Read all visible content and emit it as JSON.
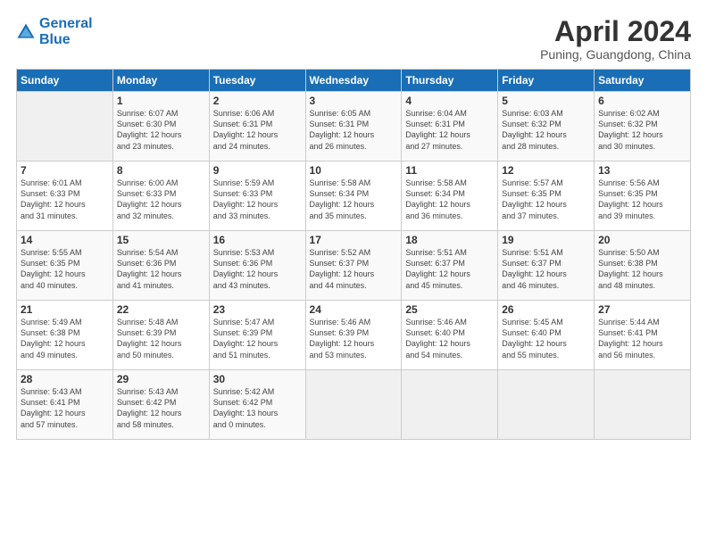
{
  "header": {
    "logo_line1": "General",
    "logo_line2": "Blue",
    "month": "April 2024",
    "location": "Puning, Guangdong, China"
  },
  "columns": [
    "Sunday",
    "Monday",
    "Tuesday",
    "Wednesday",
    "Thursday",
    "Friday",
    "Saturday"
  ],
  "weeks": [
    [
      {
        "day": "",
        "info": ""
      },
      {
        "day": "1",
        "info": "Sunrise: 6:07 AM\nSunset: 6:30 PM\nDaylight: 12 hours\nand 23 minutes."
      },
      {
        "day": "2",
        "info": "Sunrise: 6:06 AM\nSunset: 6:31 PM\nDaylight: 12 hours\nand 24 minutes."
      },
      {
        "day": "3",
        "info": "Sunrise: 6:05 AM\nSunset: 6:31 PM\nDaylight: 12 hours\nand 26 minutes."
      },
      {
        "day": "4",
        "info": "Sunrise: 6:04 AM\nSunset: 6:31 PM\nDaylight: 12 hours\nand 27 minutes."
      },
      {
        "day": "5",
        "info": "Sunrise: 6:03 AM\nSunset: 6:32 PM\nDaylight: 12 hours\nand 28 minutes."
      },
      {
        "day": "6",
        "info": "Sunrise: 6:02 AM\nSunset: 6:32 PM\nDaylight: 12 hours\nand 30 minutes."
      }
    ],
    [
      {
        "day": "7",
        "info": "Sunrise: 6:01 AM\nSunset: 6:33 PM\nDaylight: 12 hours\nand 31 minutes."
      },
      {
        "day": "8",
        "info": "Sunrise: 6:00 AM\nSunset: 6:33 PM\nDaylight: 12 hours\nand 32 minutes."
      },
      {
        "day": "9",
        "info": "Sunrise: 5:59 AM\nSunset: 6:33 PM\nDaylight: 12 hours\nand 33 minutes."
      },
      {
        "day": "10",
        "info": "Sunrise: 5:58 AM\nSunset: 6:34 PM\nDaylight: 12 hours\nand 35 minutes."
      },
      {
        "day": "11",
        "info": "Sunrise: 5:58 AM\nSunset: 6:34 PM\nDaylight: 12 hours\nand 36 minutes."
      },
      {
        "day": "12",
        "info": "Sunrise: 5:57 AM\nSunset: 6:35 PM\nDaylight: 12 hours\nand 37 minutes."
      },
      {
        "day": "13",
        "info": "Sunrise: 5:56 AM\nSunset: 6:35 PM\nDaylight: 12 hours\nand 39 minutes."
      }
    ],
    [
      {
        "day": "14",
        "info": "Sunrise: 5:55 AM\nSunset: 6:35 PM\nDaylight: 12 hours\nand 40 minutes."
      },
      {
        "day": "15",
        "info": "Sunrise: 5:54 AM\nSunset: 6:36 PM\nDaylight: 12 hours\nand 41 minutes."
      },
      {
        "day": "16",
        "info": "Sunrise: 5:53 AM\nSunset: 6:36 PM\nDaylight: 12 hours\nand 43 minutes."
      },
      {
        "day": "17",
        "info": "Sunrise: 5:52 AM\nSunset: 6:37 PM\nDaylight: 12 hours\nand 44 minutes."
      },
      {
        "day": "18",
        "info": "Sunrise: 5:51 AM\nSunset: 6:37 PM\nDaylight: 12 hours\nand 45 minutes."
      },
      {
        "day": "19",
        "info": "Sunrise: 5:51 AM\nSunset: 6:37 PM\nDaylight: 12 hours\nand 46 minutes."
      },
      {
        "day": "20",
        "info": "Sunrise: 5:50 AM\nSunset: 6:38 PM\nDaylight: 12 hours\nand 48 minutes."
      }
    ],
    [
      {
        "day": "21",
        "info": "Sunrise: 5:49 AM\nSunset: 6:38 PM\nDaylight: 12 hours\nand 49 minutes."
      },
      {
        "day": "22",
        "info": "Sunrise: 5:48 AM\nSunset: 6:39 PM\nDaylight: 12 hours\nand 50 minutes."
      },
      {
        "day": "23",
        "info": "Sunrise: 5:47 AM\nSunset: 6:39 PM\nDaylight: 12 hours\nand 51 minutes."
      },
      {
        "day": "24",
        "info": "Sunrise: 5:46 AM\nSunset: 6:39 PM\nDaylight: 12 hours\nand 53 minutes."
      },
      {
        "day": "25",
        "info": "Sunrise: 5:46 AM\nSunset: 6:40 PM\nDaylight: 12 hours\nand 54 minutes."
      },
      {
        "day": "26",
        "info": "Sunrise: 5:45 AM\nSunset: 6:40 PM\nDaylight: 12 hours\nand 55 minutes."
      },
      {
        "day": "27",
        "info": "Sunrise: 5:44 AM\nSunset: 6:41 PM\nDaylight: 12 hours\nand 56 minutes."
      }
    ],
    [
      {
        "day": "28",
        "info": "Sunrise: 5:43 AM\nSunset: 6:41 PM\nDaylight: 12 hours\nand 57 minutes."
      },
      {
        "day": "29",
        "info": "Sunrise: 5:43 AM\nSunset: 6:42 PM\nDaylight: 12 hours\nand 58 minutes."
      },
      {
        "day": "30",
        "info": "Sunrise: 5:42 AM\nSunset: 6:42 PM\nDaylight: 13 hours\nand 0 minutes."
      },
      {
        "day": "",
        "info": ""
      },
      {
        "day": "",
        "info": ""
      },
      {
        "day": "",
        "info": ""
      },
      {
        "day": "",
        "info": ""
      }
    ]
  ]
}
